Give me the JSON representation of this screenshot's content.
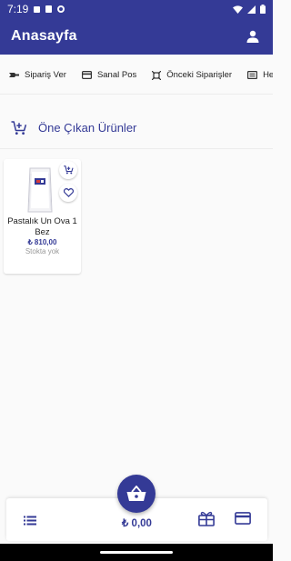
{
  "status_bar": {
    "time": "7:19",
    "icons": [
      "mail-icon",
      "sim-card-icon",
      "app-circle-icon",
      "wifi-icon",
      "signal-icon",
      "battery-icon"
    ]
  },
  "app_bar": {
    "title": "Anasayfa",
    "profile_icon": "account-icon"
  },
  "menu": {
    "items": [
      {
        "label": "Sipariş Ver",
        "icon": "order-icon"
      },
      {
        "label": "Sanal Pos",
        "icon": "credit-card-icon"
      },
      {
        "label": "Önceki Siparişler",
        "icon": "history-icon"
      },
      {
        "label": "He",
        "icon": "receipt-icon"
      }
    ]
  },
  "featured": {
    "title": "Öne Çıkan Ürünler",
    "icon": "cart-icon"
  },
  "products": [
    {
      "name": "Pastalık Un Ova 1  Bez",
      "price": "₺ 810,00",
      "stock": "Stokta yok"
    }
  ],
  "bottom_bar": {
    "total": "₺ 0,00"
  },
  "colors": {
    "primary": "#343a96",
    "background": "#fafafa",
    "muted": "#9a9a9a"
  }
}
